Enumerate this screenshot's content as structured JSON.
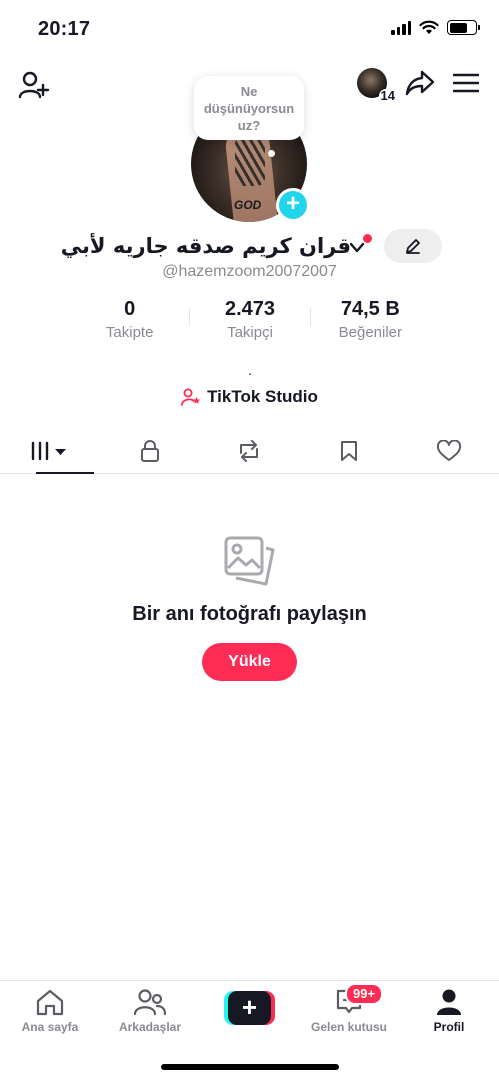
{
  "status_bar": {
    "time": "20:17"
  },
  "header": {
    "story_count": "14"
  },
  "profile": {
    "bubble_text": "Ne düşünüyorsun uz?",
    "display_name": "قران كريم صدقه جاريه لأبي",
    "avatar_caption": "GOD",
    "username": "@hazemzoom20072007",
    "bio": ".",
    "stats": [
      {
        "value": "0",
        "label": "Takipte"
      },
      {
        "value": "2.473",
        "label": "Takipçi"
      },
      {
        "value": "74,5 B",
        "label": "Beğeniler"
      }
    ],
    "studio_label": "TikTok Studio"
  },
  "empty_state": {
    "title": "Bir anı fotoğrafı paylaşın",
    "button_label": "Yükle"
  },
  "bottom_nav": {
    "home": "Ana sayfa",
    "friends": "Arkadaşlar",
    "inbox": "Gelen kutusu",
    "inbox_badge": "99+",
    "profile": "Profil"
  },
  "colors": {
    "accent": "#fe2c55",
    "cyan": "#25f4ee",
    "badge_blue": "#20d5ec",
    "text": "#161823",
    "muted": "#8a8b91"
  }
}
